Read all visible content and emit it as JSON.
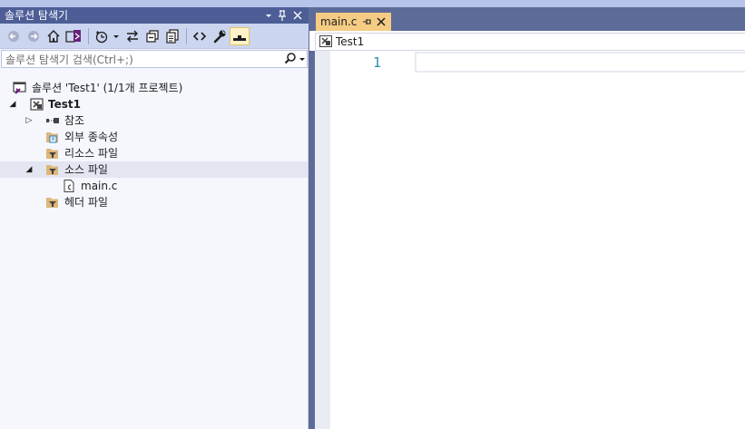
{
  "solution_explorer": {
    "title": "솔루션 탐색기",
    "search_placeholder": "솔루션 탐색기 검색(Ctrl+;)",
    "tree": {
      "solution": "솔루션 'Test1' (1/1개 프로젝트)",
      "project": "Test1",
      "references": "참조",
      "external_deps": "외부 종속성",
      "resource_files": "리소스 파일",
      "source_files": "소스 파일",
      "main_c": "main.c",
      "header_files": "헤더 파일"
    }
  },
  "editor": {
    "tab_label": "main.c",
    "nav_project": "Test1",
    "line_numbers": [
      "1"
    ]
  },
  "colors": {
    "titlebar": "#4d5e97",
    "toolbar": "#ccd5f0",
    "active_tab": "#f5cc84",
    "line_number": "#2b91af",
    "frame": "#5d6b99"
  },
  "icons": {
    "title_buttons": [
      "dropdown-icon",
      "pin-icon",
      "close-icon"
    ],
    "toolbar": [
      "back-icon",
      "forward-icon",
      "home-icon",
      "switch-view-icon",
      "pending-changes-icon",
      "sync-icon",
      "collapse-all-icon",
      "show-all-files-icon",
      "view-code-icon",
      "properties-icon",
      "preview-icon"
    ]
  }
}
